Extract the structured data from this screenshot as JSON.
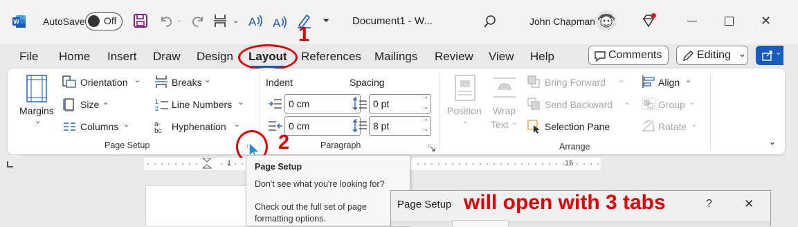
{
  "titlebar": {
    "autosave_label": "AutoSave",
    "autosave_state": "Off",
    "document_title": "Document1  -  W...",
    "user_name": "John Chapman"
  },
  "menu": {
    "tabs": [
      "File",
      "Home",
      "Insert",
      "Draw",
      "Design",
      "Layout",
      "References",
      "Mailings",
      "Review",
      "View",
      "Help"
    ],
    "active_tab": "Layout",
    "comments_label": "Comments",
    "editing_label": "Editing"
  },
  "ribbon": {
    "page_setup": {
      "margins_label": "Margins",
      "orientation_label": "Orientation",
      "size_label": "Size",
      "columns_label": "Columns",
      "breaks_label": "Breaks",
      "line_numbers_label": "Line Numbers",
      "hyphenation_label": "Hyphenation",
      "group_label": "Page Setup"
    },
    "paragraph": {
      "indent_label": "Indent",
      "spacing_label": "Spacing",
      "indent_left": "0 cm",
      "indent_right": "0 cm",
      "spacing_before": "0 pt",
      "spacing_after": "8 pt",
      "group_label": "Paragraph"
    },
    "arrange": {
      "position_label": "Position",
      "wrap_text_label_1": "Wrap",
      "wrap_text_label_2": "Text",
      "bring_forward_label": "Bring Forward",
      "send_backward_label": "Send Backward",
      "selection_pane_label": "Selection Pane",
      "align_label": "Align",
      "group_obj_label": "Group",
      "rotate_label": "Rotate",
      "group_label": "Arrange"
    }
  },
  "ruler": {
    "left_numbers": [
      "1",
      "1"
    ],
    "right_numbers": [
      "15"
    ]
  },
  "tooltip": {
    "title": "Page Setup",
    "line1": "Don't see what you're looking for?",
    "line2": "Check out the full set of page",
    "line3": "formatting options."
  },
  "dialog": {
    "title": "Page Setup",
    "help": "?",
    "close": "✕"
  },
  "annotations": {
    "step1": "1",
    "step2": "2",
    "message": "will open with 3 tabs"
  },
  "colors": {
    "annotation_red": "#e00000",
    "word_blue": "#185abd",
    "active_underline": "#185abd"
  }
}
